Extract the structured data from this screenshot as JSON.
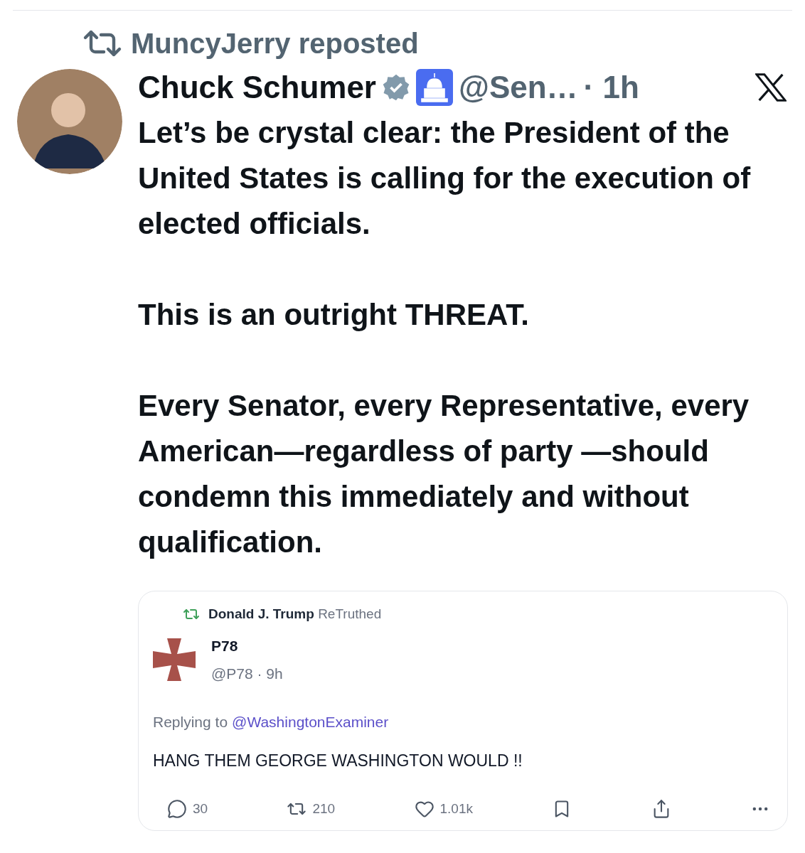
{
  "repost_banner": {
    "text": "MuncyJerry reposted"
  },
  "post": {
    "author": "Chuck Schumer",
    "verified": true,
    "handle": "@Sen…",
    "time": "· 1h",
    "paragraphs": [
      "Let’s be crystal clear: the President of the United States is calling for the execution of elected officials.",
      "This is an outright THREAT.",
      "Every Senator, every Representative, every American—regardless of party —should condemn this immediately and without qualification."
    ]
  },
  "embedded_post": {
    "retruth_user": "Donald J. Trump",
    "retruth_label": "ReTruthed",
    "author": "P78",
    "handle": "@P78 · 9h",
    "replying_label": "Replying to",
    "replying_to": "@WashingtonExaminer",
    "text": "HANG THEM GEORGE WASHINGTON WOULD !!",
    "actions": [
      {
        "kind": "reply",
        "count": "30"
      },
      {
        "kind": "repost",
        "count": "210"
      },
      {
        "kind": "like",
        "count": "1.01k"
      },
      {
        "kind": "bookmark"
      },
      {
        "kind": "share"
      },
      {
        "kind": "more"
      }
    ]
  }
}
